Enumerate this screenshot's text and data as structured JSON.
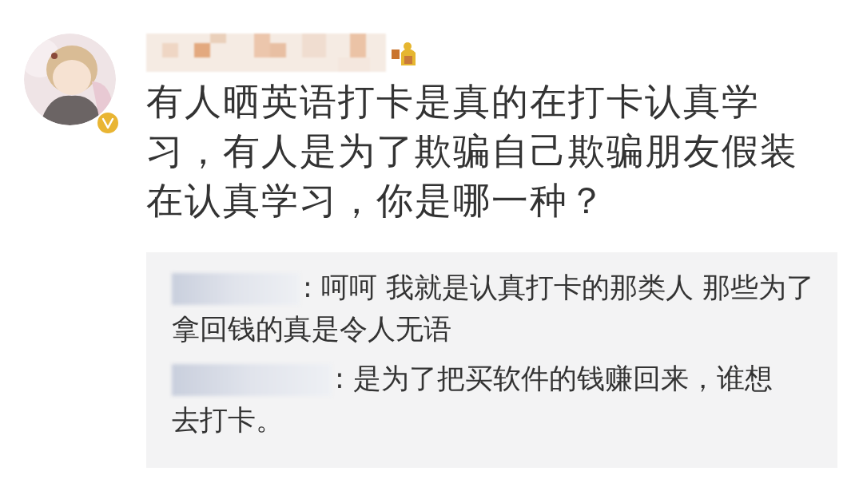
{
  "post": {
    "author_verified": true,
    "text": "有人晒英语打卡是真的在打卡认真学习，有人是为了欺骗自己欺骗朋友假装在认真学习，你是哪一种？"
  },
  "comments": [
    {
      "text": ": 呵呵 我就是认真打卡的那类人 那些为了拿回钱的真是令人无语"
    },
    {
      "text": ": 是为了把买软件的钱赚回来，谁想去打卡。"
    }
  ]
}
